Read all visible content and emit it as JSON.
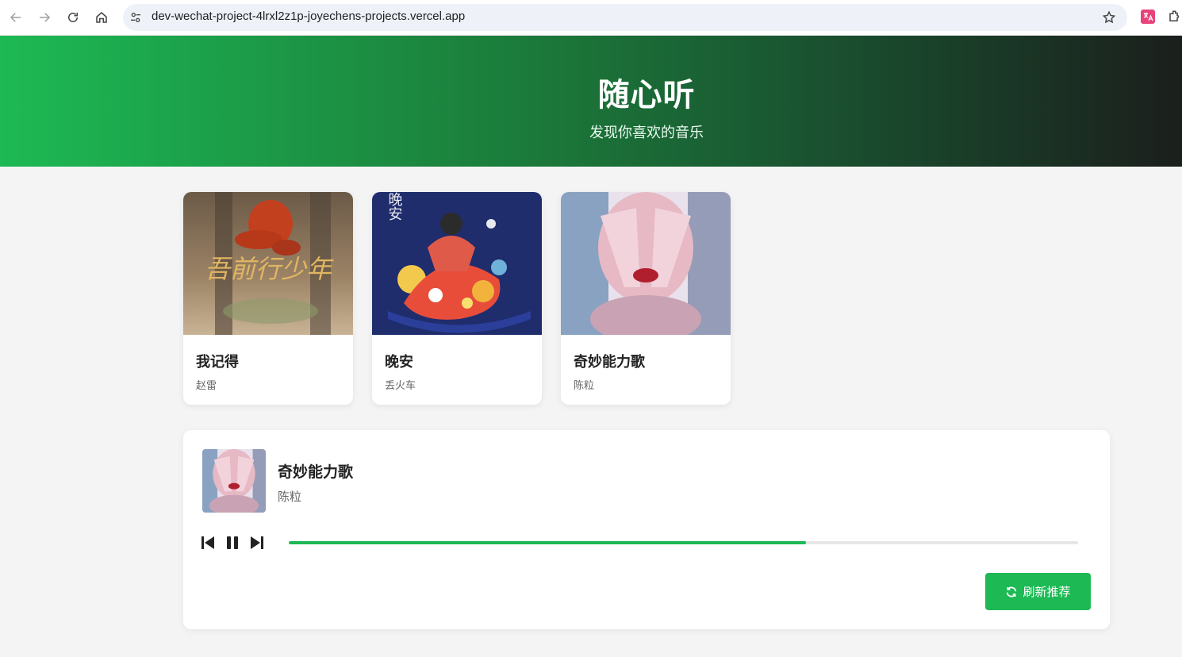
{
  "browser": {
    "url": "dev-wechat-project-4lrxl2z1p-joyechens-projects.vercel.app",
    "icons": [
      "back-icon",
      "forward-icon",
      "reload-icon",
      "home-icon",
      "site-settings-icon",
      "bookmark-star-icon",
      "translate-extension-icon",
      "extensions-icon"
    ]
  },
  "hero": {
    "title": "随心听",
    "subtitle": "发现你喜欢的音乐"
  },
  "songs": [
    {
      "title": "我记得",
      "artist": "赵雷",
      "cover_text": "吾前行少年"
    },
    {
      "title": "晚安",
      "artist": "丢火车",
      "cover_text": "晚安"
    },
    {
      "title": "奇妙能力歌",
      "artist": "陈粒"
    }
  ],
  "player": {
    "title": "奇妙能力歌",
    "artist": "陈粒",
    "progress": 0.655,
    "refresh_label": "刷新推荐",
    "icons": [
      "previous-icon",
      "pause-icon",
      "next-icon",
      "refresh-icon"
    ]
  },
  "colors": {
    "accent": "#1db954",
    "hero_gradient_start": "#1db954",
    "hero_gradient_end": "#1b1f1c"
  }
}
